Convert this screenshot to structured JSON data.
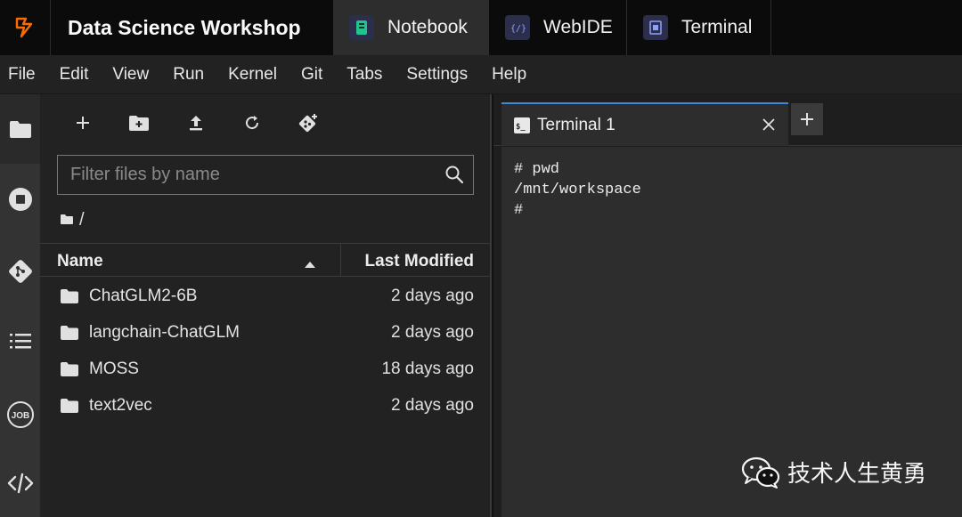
{
  "header": {
    "brand_title": "Data Science Workshop",
    "tabs": [
      {
        "label": "Notebook",
        "active": true
      },
      {
        "label": "WebIDE",
        "active": false
      },
      {
        "label": "Terminal",
        "active": false
      }
    ]
  },
  "menubar": {
    "items": [
      "File",
      "Edit",
      "View",
      "Run",
      "Kernel",
      "Git",
      "Tabs",
      "Settings",
      "Help"
    ]
  },
  "sidebar": {
    "icons": [
      "folder-icon",
      "stop-circle-icon",
      "git-icon",
      "list-icon",
      "job-icon",
      "code-icon"
    ],
    "job_label": "JOB"
  },
  "file_browser": {
    "toolbar": [
      "new-launcher-icon",
      "new-folder-icon",
      "upload-icon",
      "refresh-icon",
      "git-clone-icon"
    ],
    "filter_placeholder": "Filter files by name",
    "breadcrumb": "/",
    "columns": {
      "name": "Name",
      "modified": "Last Modified"
    },
    "files": [
      {
        "name": "ChatGLM2-6B",
        "modified": "2 days ago"
      },
      {
        "name": "langchain-ChatGLM",
        "modified": "2 days ago"
      },
      {
        "name": "MOSS",
        "modified": "18 days ago"
      },
      {
        "name": "text2vec",
        "modified": "2 days ago"
      }
    ]
  },
  "terminal": {
    "tab_label": "Terminal 1",
    "lines": [
      "# pwd",
      "/mnt/workspace",
      "#"
    ]
  },
  "watermark": {
    "text": "技术人生黄勇"
  },
  "colors": {
    "accent": "#3f86d8",
    "logo": "#ff6a00"
  }
}
